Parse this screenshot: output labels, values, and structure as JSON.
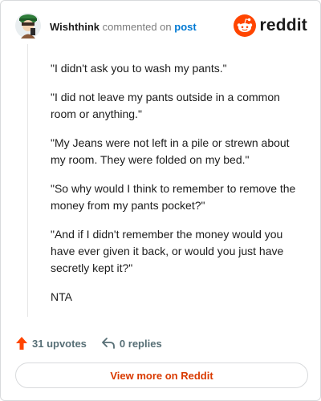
{
  "header": {
    "author": "Wishthink",
    "commented_on": "commented on",
    "post_link": "post",
    "brand": "reddit"
  },
  "comment": {
    "paragraphs": [
      "\"I didn't ask you to wash my pants.\"",
      "\"I did not leave my pants outside in a common room or anything.\"",
      "\"My Jeans were not left in a pile or strewn about my room. They were folded on my bed.\"",
      "\"So why would I think to remember to remove the money from my pants pocket?\"",
      "\"And if I didn't remember the money would you have ever given it back, or would you just have secretly kept it?\"",
      "NTA"
    ]
  },
  "actions": {
    "upvotes": "31 upvotes",
    "replies": "0 replies"
  },
  "footer": {
    "view_more": "View more on Reddit"
  },
  "icons": {
    "upvote": "upvote-arrow-icon",
    "reply": "reply-arrow-icon",
    "brand": "reddit-snoo-icon",
    "avatar": "user-avatar"
  },
  "colors": {
    "reddit_orange": "#FF4500",
    "link_blue": "#0079D3",
    "view_more_text": "#D93A00",
    "meta_gray": "#576F76"
  }
}
